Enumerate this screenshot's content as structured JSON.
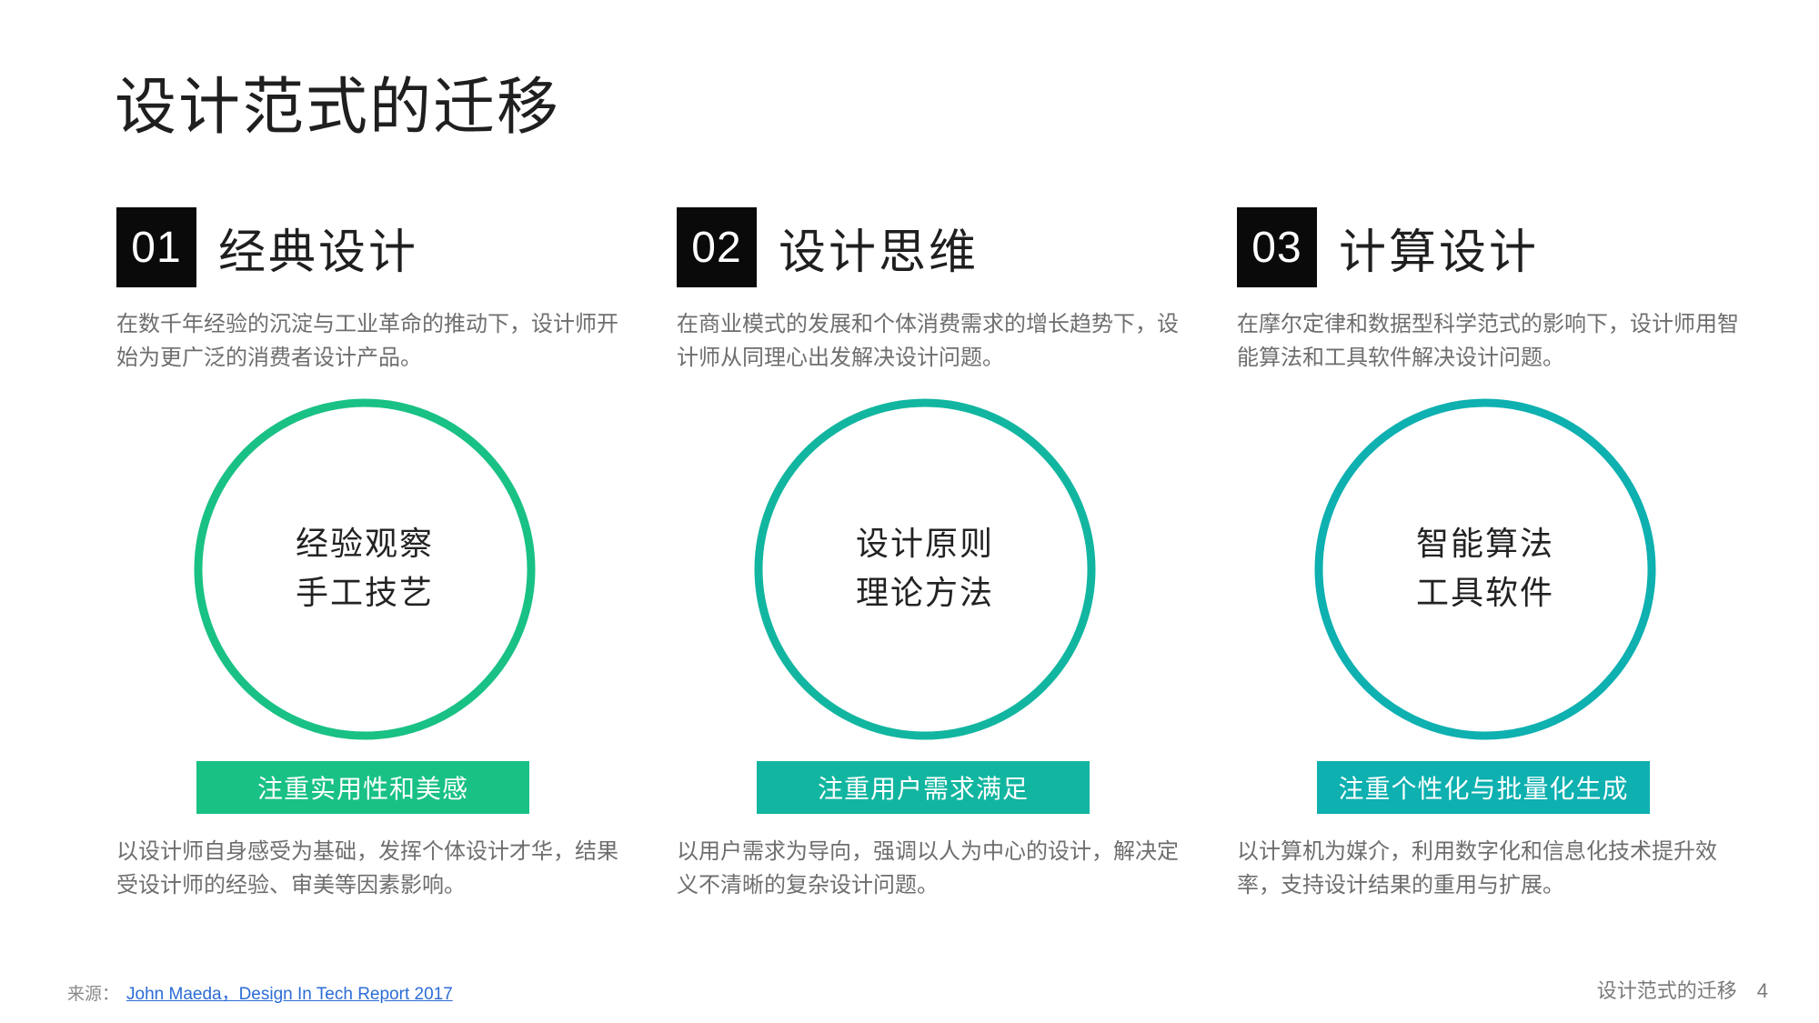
{
  "title": "设计范式的迁移",
  "colors": {
    "green": "#19c184",
    "teal_green": "#12b6a0",
    "teal": "#0eb0b0",
    "number_box": "#0a0a0a"
  },
  "columns": [
    {
      "number": "01",
      "title": "经典设计",
      "description": "在数千年经验的沉淀与工业革命的推动下，设计师开始为更广泛的消费者设计产品。",
      "circle_line1": "经验观察",
      "circle_line2": "手工技艺",
      "tag": "注重实用性和美感",
      "note": "以设计师自身感受为基础，发挥个体设计才华，结果受设计师的经验、审美等因素影响。"
    },
    {
      "number": "02",
      "title": "设计思维",
      "description": "在商业模式的发展和个体消费需求的增长趋势下，设计师从同理心出发解决设计问题。",
      "circle_line1": "设计原则",
      "circle_line2": "理论方法",
      "tag": "注重用户需求满足",
      "note": "以用户需求为导向，强调以人为中心的设计，解决定义不清晰的复杂设计问题。"
    },
    {
      "number": "03",
      "title": "计算设计",
      "description": "在摩尔定律和数据型科学范式的影响下，设计师用智能算法和工具软件解决设计问题。",
      "circle_line1": "智能算法",
      "circle_line2": "工具软件",
      "tag": "注重个性化与批量化生成",
      "note": "以计算机为媒介，利用数字化和信息化技术提升效率，支持设计结果的重用与扩展。"
    }
  ],
  "footer": {
    "source_label": "来源：",
    "source_link": "John Maeda，Design In Tech Report 2017",
    "section_title": "设计范式的迁移",
    "page_number": "4"
  }
}
